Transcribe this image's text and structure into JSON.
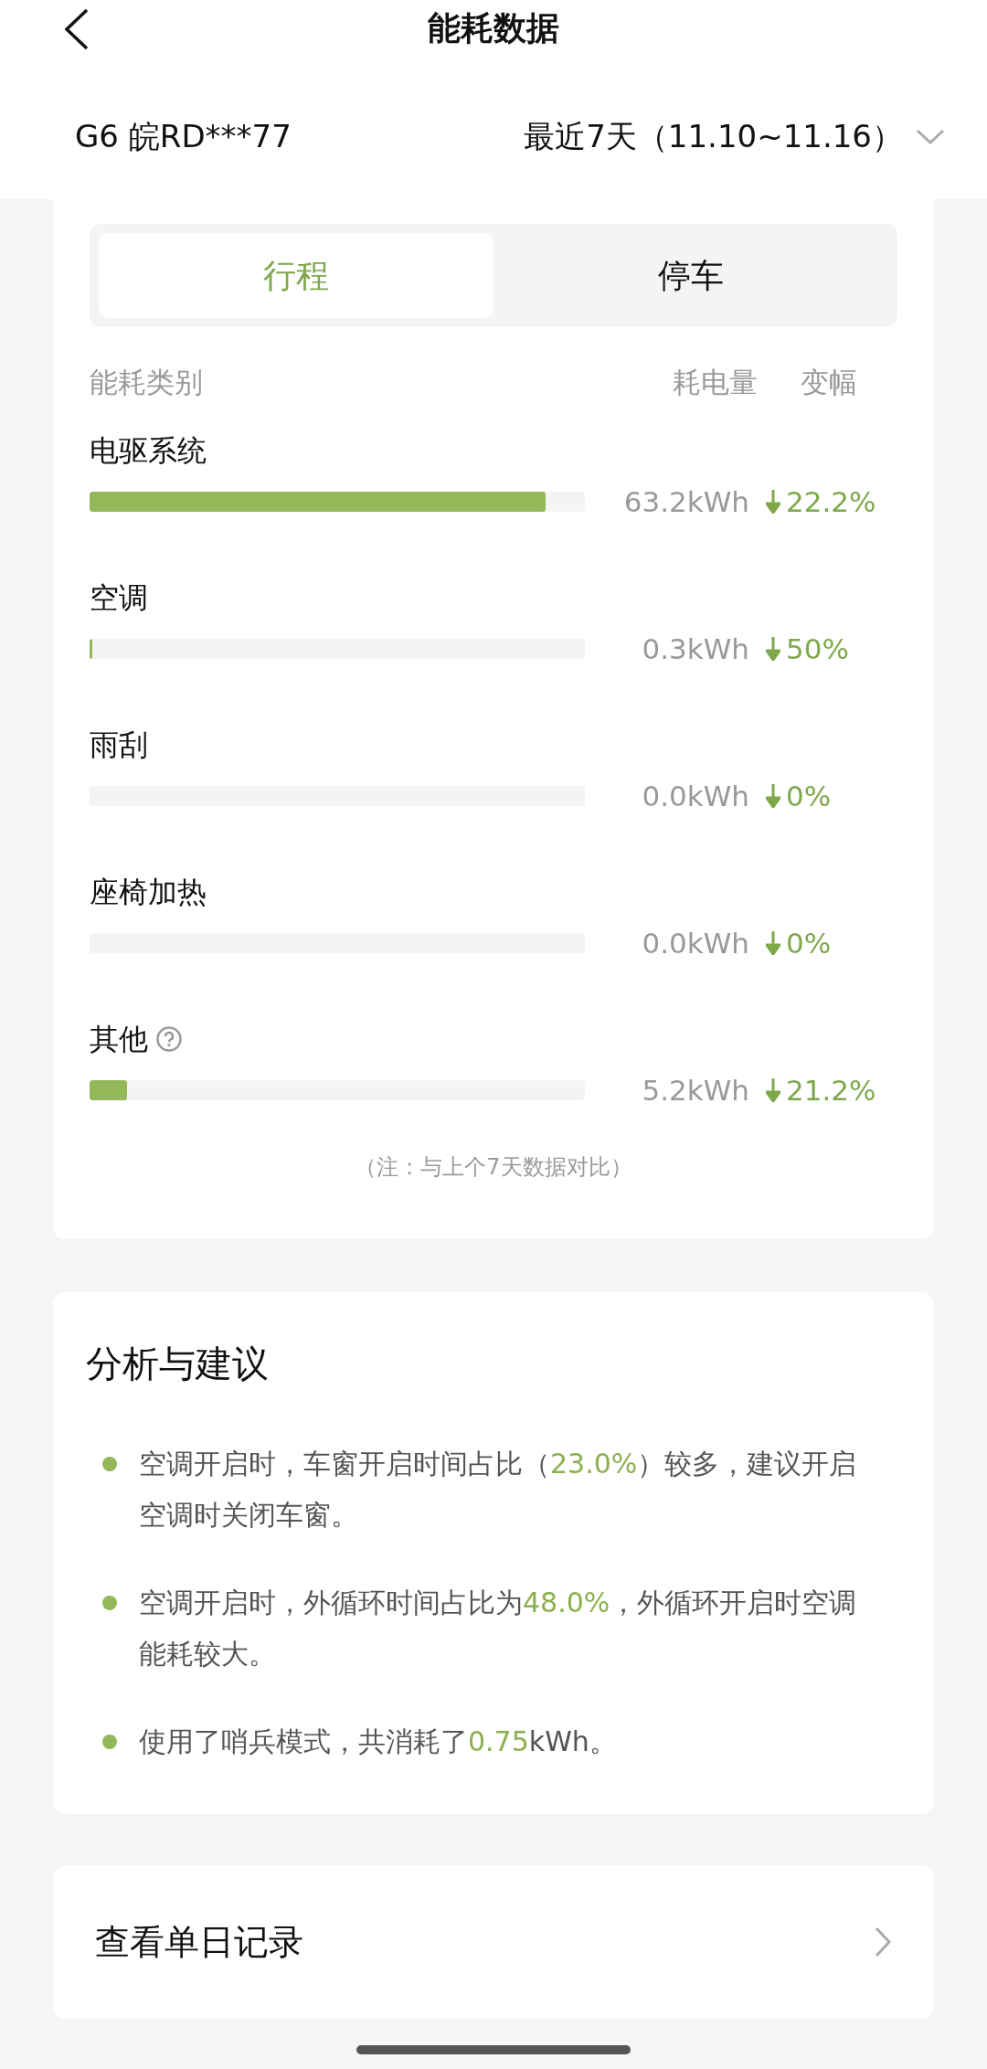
{
  "header": {
    "title": "能耗数据"
  },
  "vehicle": "G6 皖RD***77",
  "period": "最近7天（11.10~11.16）",
  "tabs": [
    {
      "label": "行程",
      "selected": true
    },
    {
      "label": "停车",
      "selected": false
    }
  ],
  "columns": [
    "能耗类别",
    "耗电量",
    "变幅"
  ],
  "categories": [
    {
      "name": "电驱系统",
      "help": false,
      "level": 0.92,
      "energy": "63.2kWh",
      "change": "22.2%"
    },
    {
      "name": "空调",
      "help": false,
      "level": 0.005,
      "energy": "0.3kWh",
      "change": "50%"
    },
    {
      "name": "雨刮",
      "help": false,
      "level": 0,
      "energy": "0.0kWh",
      "change": "0%"
    },
    {
      "name": "座椅加热",
      "help": false,
      "level": 0,
      "energy": "0.0kWh",
      "change": "0%"
    },
    {
      "name": "其他",
      "help": true,
      "level": 0.075,
      "energy": "5.2kWh",
      "change": "21.2%"
    }
  ],
  "note": "（注：与上个7天数据对比）",
  "analysis": {
    "title": "分析与建议",
    "items": [
      [
        {
          "text": "空调开启时，车窗开启时间占比（",
          "highlight": false
        },
        {
          "text": "23.0%",
          "highlight": true
        },
        {
          "text": "）较多，建议开启空调时关闭车窗。",
          "highlight": false
        }
      ],
      [
        {
          "text": "空调开启时，外循环时间占比为",
          "highlight": false
        },
        {
          "text": "48.0%",
          "highlight": true
        },
        {
          "text": "，外循环开启时空调能耗较大。",
          "highlight": false
        }
      ],
      [
        {
          "text": "使用了哨兵模式，共消耗了",
          "highlight": false
        },
        {
          "text": "0.75",
          "highlight": true
        },
        {
          "text": "kWh。",
          "highlight": false
        }
      ]
    ]
  },
  "daily_link": "查看单日记录"
}
